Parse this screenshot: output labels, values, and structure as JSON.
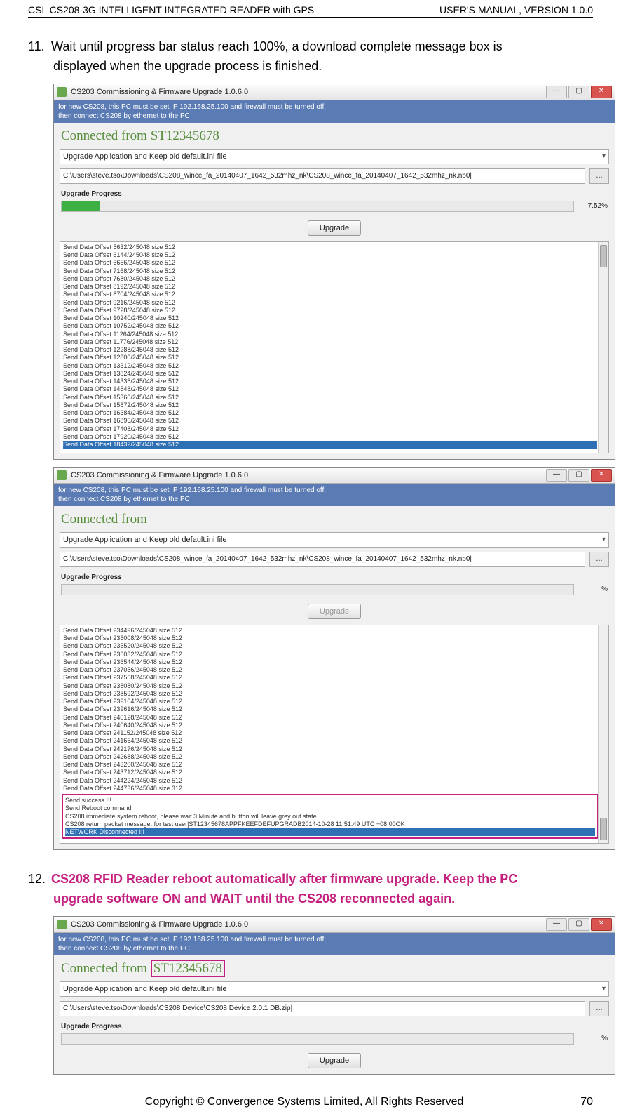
{
  "header": {
    "left": "CSL CS208-3G INTELLIGENT INTEGRATED READER with GPS",
    "right": "USER'S  MANUAL,  VERSION  1.0.0"
  },
  "step11": {
    "num": "11.",
    "line1": "Wait until progress bar status reach 100%, a download complete message box is",
    "line2": "displayed when the upgrade process is finished."
  },
  "step12": {
    "num": "12.",
    "line1": "CS208 RFID Reader reboot automatically after firmware upgrade. Keep the PC",
    "line2": "upgrade software ON and WAIT until the CS208 reconnected again."
  },
  "app_title": "CS203 Commissioning & Firmware Upgrade 1.0.6.0",
  "topnote1": "for new CS208, this PC must be set IP 192.168.25.100 and firewall must be turned off,",
  "topnote2": "then connect CS208 by ethernet to the PC",
  "conn_from": "Connected from",
  "sn": "ST12345678",
  "combo_text": "Upgrade Application and Keep old default.ini file",
  "path1": "C:\\Users\\steve.tso\\Downloads\\CS208_wince_fa_20140407_1642_532mhz_nk\\CS208_wince_fa_20140407_1642_532mhz_nk.nb0|",
  "path3": "C:\\Users\\steve.tso\\Downloads\\CS208 Device\\CS208 Device 2.0.1 DB.zip|",
  "upgrade_progress_label": "Upgrade Progress",
  "pct1": "7.52%",
  "pct2": "%",
  "pct3": "%",
  "upgrade_btn": "Upgrade",
  "browse_btn": "...",
  "win_min": "—",
  "win_max": "▢",
  "win_close": "✕",
  "caret": "▾",
  "log1_lines": [
    "Send Data Offset 5632/245048 size 512",
    "Send Data Offset 6144/245048 size 512",
    "Send Data Offset 6656/245048 size 512",
    "Send Data Offset 7168/245048 size 512",
    "Send Data Offset 7680/245048 size 512",
    "Send Data Offset 8192/245048 size 512",
    "Send Data Offset 8704/245048 size 512",
    "Send Data Offset 9216/245048 size 512",
    "Send Data Offset 9728/245048 size 512",
    "Send Data Offset 10240/245048 size 512",
    "Send Data Offset 10752/245048 size 512",
    "Send Data Offset 11264/245048 size 512",
    "Send Data Offset 11776/245048 size 512",
    "Send Data Offset 12288/245048 size 512",
    "Send Data Offset 12800/245048 size 512",
    "Send Data Offset 13312/245048 size 512",
    "Send Data Offset 13824/245048 size 512",
    "Send Data Offset 14336/245048 size 512",
    "Send Data Offset 14848/245048 size 512",
    "Send Data Offset 15360/245048 size 512",
    "Send Data Offset 15872/245048 size 512",
    "Send Data Offset 16384/245048 size 512",
    "Send Data Offset 16896/245048 size 512",
    "Send Data Offset 17408/245048 size 512",
    "Send Data Offset 17920/245048 size 512"
  ],
  "log1_sel": "Send Data Offset 18432/245048 size 512",
  "log2_lines": [
    "Send Data Offset 234496/245048 size 512",
    "Send Data Offset 235008/245048 size 512",
    "Send Data Offset 235520/245048 size 512",
    "Send Data Offset 236032/245048 size 512",
    "Send Data Offset 236544/245048 size 512",
    "Send Data Offset 237056/245048 size 512",
    "Send Data Offset 237568/245048 size 512",
    "Send Data Offset 238080/245048 size 512",
    "Send Data Offset 238592/245048 size 512",
    "Send Data Offset 239104/245048 size 512",
    "Send Data Offset 239616/245048 size 512",
    "Send Data Offset 240128/245048 size 512",
    "Send Data Offset 240640/245048 size 512",
    "Send Data Offset 241152/245048 size 512",
    "Send Data Offset 241664/245048 size 512",
    "Send Data Offset 242176/245048 size 512",
    "Send Data Offset 242688/245048 size 512",
    "Send Data Offset 243200/245048 size 512",
    "Send Data Offset 243712/245048 size 512",
    "Send Data Offset 244224/245048 size 512",
    "Send Data Offset 244736/245048 size 312"
  ],
  "log2_callout": [
    "Send success !!!",
    "Send Reboot command",
    "CS208 immediate system reboot, please wait 3 Minute and button will leave grey out state",
    "CS208 return packet message: for test user|ST12345678APPFKEEFDEFUPGRADB2014-10-28 11:51:49 UTC +08:00OK"
  ],
  "log2_sel": "NETWORK Disconnected !!!",
  "footer": {
    "center": "Copyright © Convergence Systems Limited, All Rights Reserved",
    "page": "70"
  }
}
